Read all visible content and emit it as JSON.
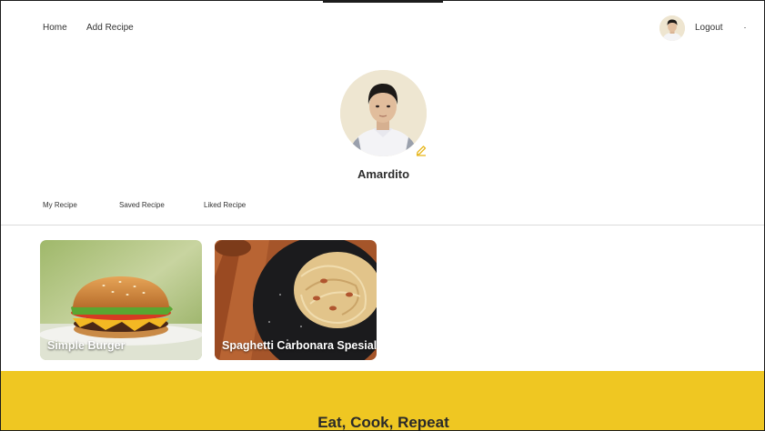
{
  "nav": {
    "home": "Home",
    "add_recipe": "Add Recipe",
    "logout": "Logout"
  },
  "profile": {
    "name": "Amardito"
  },
  "tabs": [
    "My Recipe",
    "Saved Recipe",
    "Liked Recipe"
  ],
  "recipes": [
    {
      "title": "Simple Burger",
      "image": "burger"
    },
    {
      "title": "Spaghetti Carbonara Spesial",
      "image": "pasta"
    }
  ],
  "footer": {
    "title": "Eat, Cook, Repeat"
  },
  "colors": {
    "accent": "#efc722",
    "edit_icon": "#e7b720"
  },
  "icons": {
    "edit": "pencil-icon"
  }
}
